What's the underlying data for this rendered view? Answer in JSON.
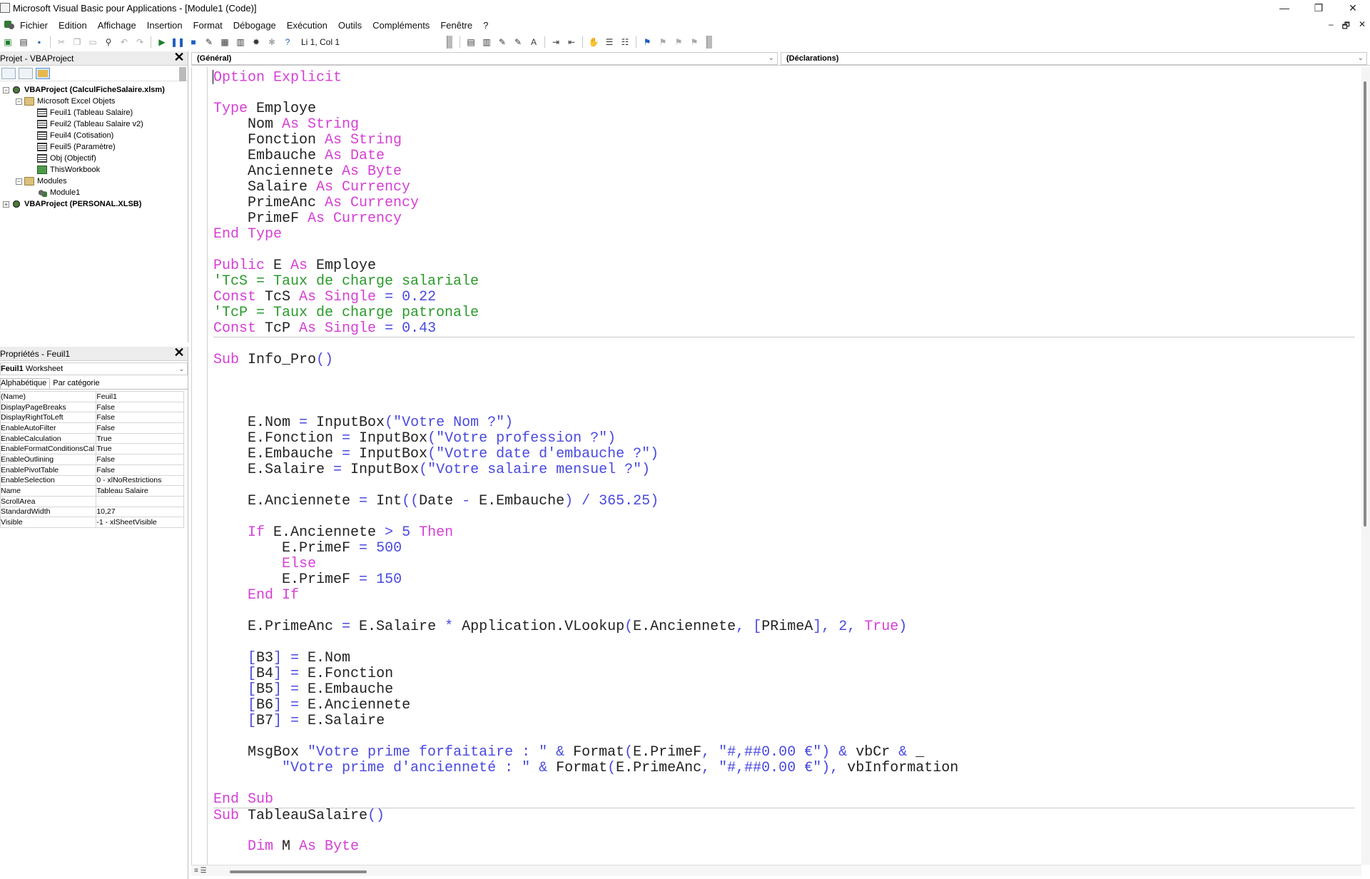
{
  "window": {
    "title": "Microsoft Visual Basic pour Applications - [Module1 (Code)]",
    "controls": [
      "—",
      "❐",
      "✕"
    ]
  },
  "menu": {
    "items": [
      "Fichier",
      "Edition",
      "Affichage",
      "Insertion",
      "Format",
      "Débogage",
      "Exécution",
      "Outils",
      "Compléments",
      "Fenêtre",
      "?"
    ],
    "mdi_controls": [
      "–",
      "🗗",
      "✕"
    ]
  },
  "toolbar": {
    "position": "Li 1, Col 1"
  },
  "project_panel": {
    "title": "Projet - VBAProject",
    "tree": [
      {
        "label": "VBAProject (CalculFicheSalaire.xlsm)",
        "level": 0,
        "toggle": "−",
        "icon": "proj",
        "bold": true
      },
      {
        "label": "Microsoft Excel Objets",
        "level": 1,
        "toggle": "−",
        "icon": "fold",
        "bold": false
      },
      {
        "label": "Feuil1 (Tableau Salaire)",
        "level": 2,
        "toggle": "",
        "icon": "sheet",
        "bold": false
      },
      {
        "label": "Feuil2 (Tableau Salaire v2)",
        "level": 2,
        "toggle": "",
        "icon": "sheet",
        "bold": false
      },
      {
        "label": "Feuil4 (Cotisation)",
        "level": 2,
        "toggle": "",
        "icon": "sheet",
        "bold": false
      },
      {
        "label": "Feuil5 (Paramètre)",
        "level": 2,
        "toggle": "",
        "icon": "sheet",
        "bold": false
      },
      {
        "label": "Obj (Objectif)",
        "level": 2,
        "toggle": "",
        "icon": "sheet",
        "bold": false
      },
      {
        "label": "ThisWorkbook",
        "level": 2,
        "toggle": "",
        "icon": "book",
        "bold": false
      },
      {
        "label": "Modules",
        "level": 1,
        "toggle": "−",
        "icon": "fold",
        "bold": false
      },
      {
        "label": "Module1",
        "level": 2,
        "toggle": "",
        "icon": "mod",
        "bold": false
      },
      {
        "label": "VBAProject (PERSONAL.XLSB)",
        "level": 0,
        "toggle": "+",
        "icon": "proj",
        "bold": true
      }
    ]
  },
  "properties_panel": {
    "title": "Propriétés - Feuil1",
    "object_name": "Feuil1",
    "object_type": "Worksheet",
    "tabs": [
      "Alphabétique",
      "Par catégorie"
    ],
    "rows": [
      {
        "name": "(Name)",
        "value": "Feuil1"
      },
      {
        "name": "DisplayPageBreaks",
        "value": "False"
      },
      {
        "name": "DisplayRightToLeft",
        "value": "False"
      },
      {
        "name": "EnableAutoFilter",
        "value": "False"
      },
      {
        "name": "EnableCalculation",
        "value": "True"
      },
      {
        "name": "EnableFormatConditionsCal",
        "value": "True"
      },
      {
        "name": "EnableOutlining",
        "value": "False"
      },
      {
        "name": "EnablePivotTable",
        "value": "False"
      },
      {
        "name": "EnableSelection",
        "value": "0 - xlNoRestrictions"
      },
      {
        "name": "Name",
        "value": "Tableau Salaire"
      },
      {
        "name": "ScrollArea",
        "value": ""
      },
      {
        "name": "StandardWidth",
        "value": "10,27"
      },
      {
        "name": "Visible",
        "value": "-1 - xlSheetVisible"
      }
    ]
  },
  "code_window": {
    "object_combo": "(Général)",
    "procedure_combo": "(Déclarations)",
    "lines": [
      {
        "sep": false,
        "tokens": [
          [
            "kw",
            "Option Explicit"
          ]
        ]
      },
      {
        "sep": false,
        "tokens": []
      },
      {
        "sep": false,
        "tokens": [
          [
            "kw",
            "Type "
          ],
          [
            "id",
            "Employe"
          ]
        ]
      },
      {
        "sep": false,
        "tokens": [
          [
            "id",
            "    Nom "
          ],
          [
            "kw",
            "As String"
          ]
        ]
      },
      {
        "sep": false,
        "tokens": [
          [
            "id",
            "    Fonction "
          ],
          [
            "kw",
            "As String"
          ]
        ]
      },
      {
        "sep": false,
        "tokens": [
          [
            "id",
            "    Embauche "
          ],
          [
            "kw",
            "As Date"
          ]
        ]
      },
      {
        "sep": false,
        "tokens": [
          [
            "id",
            "    Anciennete "
          ],
          [
            "kw",
            "As Byte"
          ]
        ]
      },
      {
        "sep": false,
        "tokens": [
          [
            "id",
            "    Salaire "
          ],
          [
            "kw",
            "As Currency"
          ]
        ]
      },
      {
        "sep": false,
        "tokens": [
          [
            "id",
            "    PrimeAnc "
          ],
          [
            "kw",
            "As Currency"
          ]
        ]
      },
      {
        "sep": false,
        "tokens": [
          [
            "id",
            "    PrimeF "
          ],
          [
            "kw",
            "As Currency"
          ]
        ]
      },
      {
        "sep": false,
        "tokens": [
          [
            "kw",
            "End Type"
          ]
        ]
      },
      {
        "sep": false,
        "tokens": []
      },
      {
        "sep": false,
        "tokens": [
          [
            "kw",
            "Public "
          ],
          [
            "id",
            "E "
          ],
          [
            "kw",
            "As "
          ],
          [
            "id",
            "Employe"
          ]
        ]
      },
      {
        "sep": false,
        "tokens": [
          [
            "cm",
            "'TcS = Taux de charge salariale"
          ]
        ]
      },
      {
        "sep": false,
        "tokens": [
          [
            "kw",
            "Const "
          ],
          [
            "id",
            "TcS "
          ],
          [
            "kw",
            "As Single "
          ],
          [
            "op",
            "= "
          ],
          [
            "nm",
            "0.22"
          ]
        ]
      },
      {
        "sep": false,
        "tokens": [
          [
            "cm",
            "'TcP = Taux de charge patronale"
          ]
        ]
      },
      {
        "sep": false,
        "tokens": [
          [
            "kw",
            "Const "
          ],
          [
            "id",
            "TcP "
          ],
          [
            "kw",
            "As Single "
          ],
          [
            "op",
            "= "
          ],
          [
            "nm",
            "0.43"
          ]
        ]
      },
      {
        "sep": true,
        "tokens": []
      },
      {
        "sep": false,
        "tokens": [
          [
            "kw",
            "Sub "
          ],
          [
            "id",
            "Info_Pro"
          ],
          [
            "op",
            "()"
          ]
        ]
      },
      {
        "sep": false,
        "tokens": []
      },
      {
        "sep": false,
        "tokens": []
      },
      {
        "sep": false,
        "tokens": []
      },
      {
        "sep": false,
        "tokens": [
          [
            "id",
            "    E.Nom "
          ],
          [
            "op",
            "= "
          ],
          [
            "id",
            "InputBox"
          ],
          [
            "op",
            "("
          ],
          [
            "st",
            "\"Votre Nom ?\""
          ],
          [
            "op",
            ")"
          ]
        ]
      },
      {
        "sep": false,
        "tokens": [
          [
            "id",
            "    E.Fonction "
          ],
          [
            "op",
            "= "
          ],
          [
            "id",
            "InputBox"
          ],
          [
            "op",
            "("
          ],
          [
            "st",
            "\"Votre profession ?\""
          ],
          [
            "op",
            ")"
          ]
        ]
      },
      {
        "sep": false,
        "tokens": [
          [
            "id",
            "    E.Embauche "
          ],
          [
            "op",
            "= "
          ],
          [
            "id",
            "InputBox"
          ],
          [
            "op",
            "("
          ],
          [
            "st",
            "\"Votre date d'embauche ?\""
          ],
          [
            "op",
            ")"
          ]
        ]
      },
      {
        "sep": false,
        "tokens": [
          [
            "id",
            "    E.Salaire "
          ],
          [
            "op",
            "= "
          ],
          [
            "id",
            "InputBox"
          ],
          [
            "op",
            "("
          ],
          [
            "st",
            "\"Votre salaire mensuel ?\""
          ],
          [
            "op",
            ")"
          ]
        ]
      },
      {
        "sep": false,
        "tokens": []
      },
      {
        "sep": false,
        "tokens": [
          [
            "id",
            "    E.Anciennete "
          ],
          [
            "op",
            "= "
          ],
          [
            "id",
            "Int"
          ],
          [
            "op",
            "(("
          ],
          [
            "id",
            "Date "
          ],
          [
            "op",
            "- "
          ],
          [
            "id",
            "E.Embauche"
          ],
          [
            "op",
            ") / "
          ],
          [
            "nm",
            "365.25"
          ],
          [
            "op",
            ")"
          ]
        ]
      },
      {
        "sep": false,
        "tokens": []
      },
      {
        "sep": false,
        "tokens": [
          [
            "kw",
            "    If "
          ],
          [
            "id",
            "E.Anciennete "
          ],
          [
            "op",
            "> "
          ],
          [
            "nm",
            "5 "
          ],
          [
            "kw",
            "Then"
          ]
        ]
      },
      {
        "sep": false,
        "tokens": [
          [
            "id",
            "        E.PrimeF "
          ],
          [
            "op",
            "= "
          ],
          [
            "nm",
            "500"
          ]
        ]
      },
      {
        "sep": false,
        "tokens": [
          [
            "kw",
            "        Else"
          ]
        ]
      },
      {
        "sep": false,
        "tokens": [
          [
            "id",
            "        E.PrimeF "
          ],
          [
            "op",
            "= "
          ],
          [
            "nm",
            "150"
          ]
        ]
      },
      {
        "sep": false,
        "tokens": [
          [
            "kw",
            "    End If"
          ]
        ]
      },
      {
        "sep": false,
        "tokens": []
      },
      {
        "sep": false,
        "tokens": [
          [
            "id",
            "    E.PrimeAnc "
          ],
          [
            "op",
            "= "
          ],
          [
            "id",
            "E.Salaire "
          ],
          [
            "op",
            "* "
          ],
          [
            "id",
            "Application.VLookup"
          ],
          [
            "op",
            "("
          ],
          [
            "id",
            "E.Anciennete"
          ],
          [
            "op",
            ", ["
          ],
          [
            "id",
            "PRimeA"
          ],
          [
            "op",
            "], "
          ],
          [
            "nm",
            "2"
          ],
          [
            "op",
            ", "
          ],
          [
            "kw",
            "True"
          ],
          [
            "op",
            ")"
          ]
        ]
      },
      {
        "sep": false,
        "tokens": []
      },
      {
        "sep": false,
        "tokens": [
          [
            "op",
            "    ["
          ],
          [
            "id",
            "B3"
          ],
          [
            "op",
            "] = "
          ],
          [
            "id",
            "E.Nom"
          ]
        ]
      },
      {
        "sep": false,
        "tokens": [
          [
            "op",
            "    ["
          ],
          [
            "id",
            "B4"
          ],
          [
            "op",
            "] = "
          ],
          [
            "id",
            "E.Fonction"
          ]
        ]
      },
      {
        "sep": false,
        "tokens": [
          [
            "op",
            "    ["
          ],
          [
            "id",
            "B5"
          ],
          [
            "op",
            "] = "
          ],
          [
            "id",
            "E.Embauche"
          ]
        ]
      },
      {
        "sep": false,
        "tokens": [
          [
            "op",
            "    ["
          ],
          [
            "id",
            "B6"
          ],
          [
            "op",
            "] = "
          ],
          [
            "id",
            "E.Anciennete"
          ]
        ]
      },
      {
        "sep": false,
        "tokens": [
          [
            "op",
            "    ["
          ],
          [
            "id",
            "B7"
          ],
          [
            "op",
            "] = "
          ],
          [
            "id",
            "E.Salaire"
          ]
        ]
      },
      {
        "sep": false,
        "tokens": []
      },
      {
        "sep": false,
        "tokens": [
          [
            "id",
            "    MsgBox "
          ],
          [
            "st",
            "\"Votre prime forfaitaire : \" "
          ],
          [
            "op",
            "& "
          ],
          [
            "id",
            "Format"
          ],
          [
            "op",
            "("
          ],
          [
            "id",
            "E.PrimeF"
          ],
          [
            "op",
            ", "
          ],
          [
            "st",
            "\"#,##0.00 €\""
          ],
          [
            "op",
            ") & "
          ],
          [
            "id",
            "vbCr "
          ],
          [
            "op",
            "& "
          ],
          [
            "id",
            "_"
          ]
        ]
      },
      {
        "sep": false,
        "tokens": [
          [
            "st",
            "        \"Votre prime d'ancienneté : \" "
          ],
          [
            "op",
            "& "
          ],
          [
            "id",
            "Format"
          ],
          [
            "op",
            "("
          ],
          [
            "id",
            "E.PrimeAnc"
          ],
          [
            "op",
            ", "
          ],
          [
            "st",
            "\"#,##0.00 €\""
          ],
          [
            "op",
            "), "
          ],
          [
            "id",
            "vbInformation"
          ]
        ]
      },
      {
        "sep": false,
        "tokens": []
      },
      {
        "sep": false,
        "tokens": [
          [
            "kw",
            "End Sub"
          ]
        ]
      },
      {
        "sep": true,
        "tokens": [
          [
            "kw",
            "Sub "
          ],
          [
            "id",
            "TableauSalaire"
          ],
          [
            "op",
            "()"
          ]
        ]
      },
      {
        "sep": false,
        "tokens": []
      },
      {
        "sep": false,
        "tokens": [
          [
            "kw",
            "    Dim "
          ],
          [
            "id",
            "M "
          ],
          [
            "kw",
            "As Byte"
          ]
        ]
      }
    ]
  }
}
